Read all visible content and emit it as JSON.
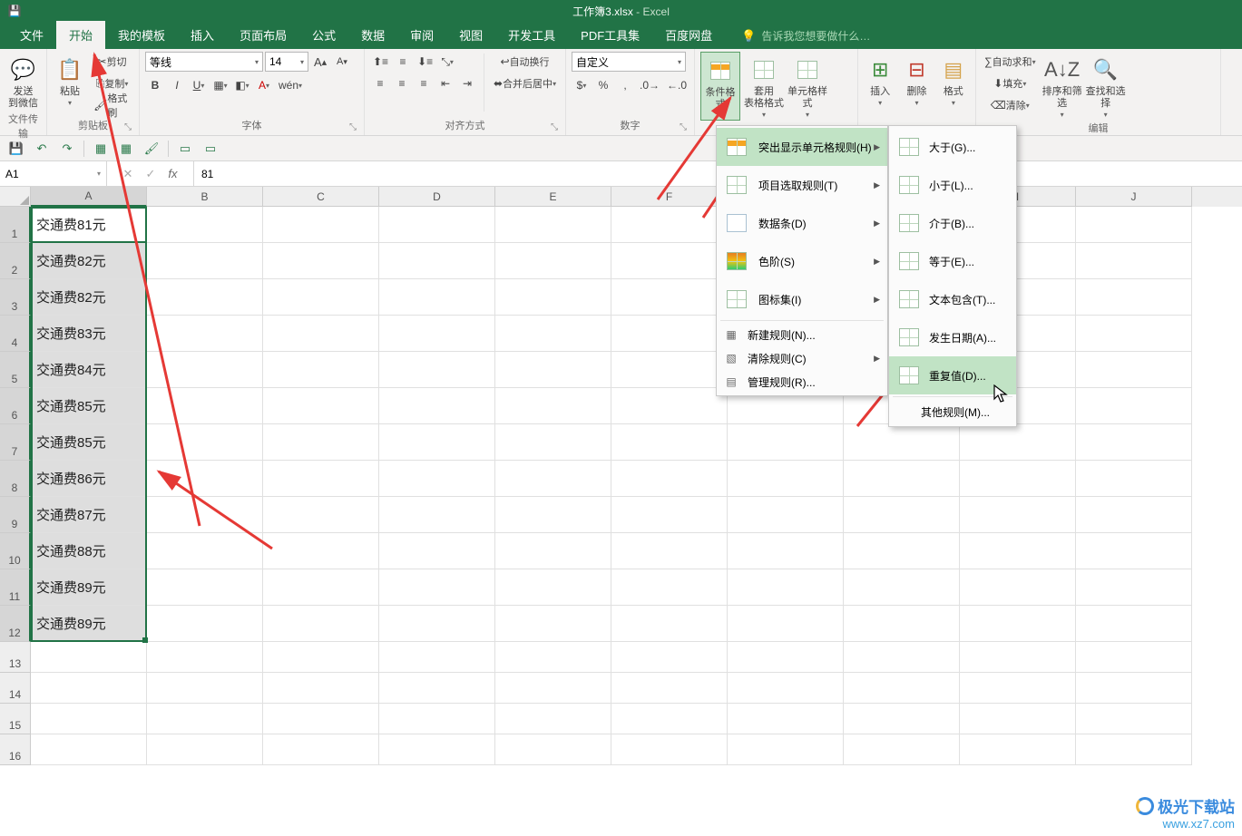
{
  "title": {
    "doc": "工作簿3.xlsx",
    "app": "Excel"
  },
  "tabs": {
    "file": "文件",
    "home": "开始",
    "tmpl": "我的模板",
    "insert": "插入",
    "layout": "页面布局",
    "formulas": "公式",
    "data": "数据",
    "review": "审阅",
    "view": "视图",
    "dev": "开发工具",
    "pdf": "PDF工具集",
    "baidu": "百度网盘",
    "tell_me": "告诉我您想要做什么…"
  },
  "ribbon": {
    "wechat": {
      "l1": "发送",
      "l2": "到微信"
    },
    "filetrans": "文件传输",
    "clipboard": {
      "paste": "粘贴",
      "cut": "剪切",
      "copy": "复制",
      "fmtpaint": "格式刷",
      "label": "剪贴板"
    },
    "font": {
      "name": "等线",
      "size": "14",
      "label": "字体"
    },
    "align": {
      "wrap": "自动换行",
      "merge": "合并后居中",
      "label": "对齐方式"
    },
    "number": {
      "style": "自定义",
      "label": "数字"
    },
    "styles": {
      "cond": "条件格式",
      "tablefmt_l1": "套用",
      "tablefmt_l2": "表格格式",
      "cellstyle": "单元格样式"
    },
    "cells": {
      "insert": "插入",
      "delete": "删除",
      "format": "格式"
    },
    "editing": {
      "sum": "自动求和",
      "fill": "填充",
      "clear": "清除",
      "sort": "排序和筛选",
      "find": "查找和选择",
      "label": "编辑"
    }
  },
  "namebox": "A1",
  "formula": "81",
  "columns": [
    "A",
    "B",
    "C",
    "D",
    "E",
    "F",
    "",
    "",
    "I",
    "J"
  ],
  "rows": [
    "交通费81元",
    "交通费82元",
    "交通费82元",
    "交通费83元",
    "交通费84元",
    "交通费85元",
    "交通费85元",
    "交通费86元",
    "交通费87元",
    "交通费88元",
    "交通费89元",
    "交通费89元"
  ],
  "menu1": {
    "highlight": "突出显示单元格规则(H)",
    "topbottom": "项目选取规则(T)",
    "databars": "数据条(D)",
    "colorscale": "色阶(S)",
    "iconset": "图标集(I)",
    "newrule": "新建规则(N)...",
    "clearrule": "清除规则(C)",
    "manage": "管理规则(R)..."
  },
  "menu2": {
    "gt": "大于(G)...",
    "lt": "小于(L)...",
    "between": "介于(B)...",
    "eq": "等于(E)...",
    "textcontains": "文本包含(T)...",
    "dateoccur": "发生日期(A)...",
    "dup": "重复值(D)...",
    "other": "其他规则(M)..."
  },
  "watermark": {
    "l1": "极光下载站",
    "l2": "www.xz7.com"
  }
}
